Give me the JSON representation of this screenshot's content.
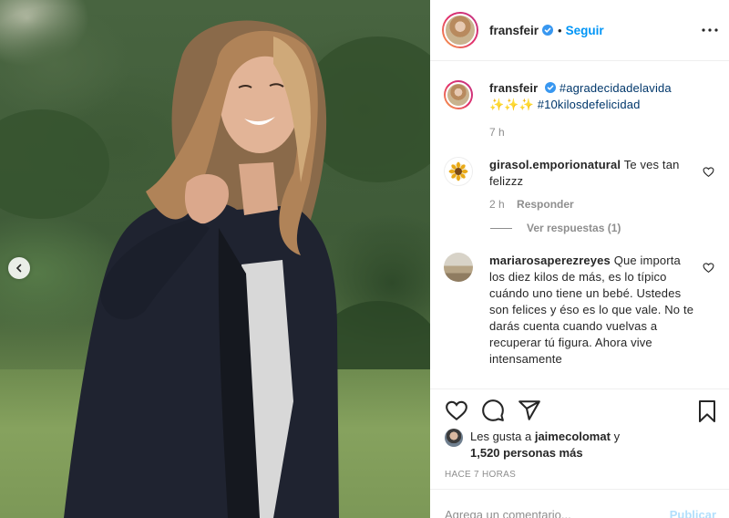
{
  "post": {
    "username": "fransfeir",
    "follow_label": "Seguir",
    "dot": "•",
    "more_icon": "ellipsis-icon",
    "verified_icon": "verified-badge-icon",
    "accent": "#0095f6"
  },
  "caption": {
    "username": "fransfeir",
    "hashtag1": "#agradecidadelavida",
    "emojis": "✨✨✨",
    "hashtag2": "#10kilosdefelicidad",
    "time": "7 h"
  },
  "comments": [
    {
      "username": "girasol.emporionatural",
      "text": "Te ves tan felizzz",
      "time": "2 h",
      "reply_label": "Responder",
      "view_replies": "Ver respuestas (1)"
    },
    {
      "username": "mariarosaperezreyes",
      "text": "Que importa los diez kilos de más, es lo típico cuándo uno tiene un bebé. Ustedes son felices y éso es lo que vale. No te darás cuenta cuando vuelvas a recuperar tú figura. Ahora vive intensamente"
    }
  ],
  "likes": {
    "prefix": "Les gusta a",
    "user": "jaimecolomat",
    "conj": "y",
    "others": "1,520 personas más"
  },
  "timeago": "HACE 7 HORAS",
  "add_comment": {
    "placeholder": "Agrega un comentario...",
    "publish_label": "Publicar"
  }
}
